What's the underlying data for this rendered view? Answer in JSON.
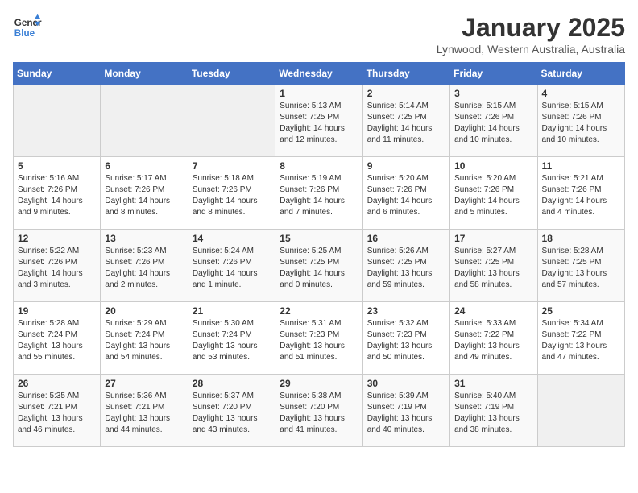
{
  "header": {
    "logo_line1": "General",
    "logo_line2": "Blue",
    "title": "January 2025",
    "subtitle": "Lynwood, Western Australia, Australia"
  },
  "days_of_week": [
    "Sunday",
    "Monday",
    "Tuesday",
    "Wednesday",
    "Thursday",
    "Friday",
    "Saturday"
  ],
  "weeks": [
    [
      {
        "day": "",
        "info": ""
      },
      {
        "day": "",
        "info": ""
      },
      {
        "day": "",
        "info": ""
      },
      {
        "day": "1",
        "info": "Sunrise: 5:13 AM\nSunset: 7:25 PM\nDaylight: 14 hours\nand 12 minutes."
      },
      {
        "day": "2",
        "info": "Sunrise: 5:14 AM\nSunset: 7:25 PM\nDaylight: 14 hours\nand 11 minutes."
      },
      {
        "day": "3",
        "info": "Sunrise: 5:15 AM\nSunset: 7:26 PM\nDaylight: 14 hours\nand 10 minutes."
      },
      {
        "day": "4",
        "info": "Sunrise: 5:15 AM\nSunset: 7:26 PM\nDaylight: 14 hours\nand 10 minutes."
      }
    ],
    [
      {
        "day": "5",
        "info": "Sunrise: 5:16 AM\nSunset: 7:26 PM\nDaylight: 14 hours\nand 9 minutes."
      },
      {
        "day": "6",
        "info": "Sunrise: 5:17 AM\nSunset: 7:26 PM\nDaylight: 14 hours\nand 8 minutes."
      },
      {
        "day": "7",
        "info": "Sunrise: 5:18 AM\nSunset: 7:26 PM\nDaylight: 14 hours\nand 8 minutes."
      },
      {
        "day": "8",
        "info": "Sunrise: 5:19 AM\nSunset: 7:26 PM\nDaylight: 14 hours\nand 7 minutes."
      },
      {
        "day": "9",
        "info": "Sunrise: 5:20 AM\nSunset: 7:26 PM\nDaylight: 14 hours\nand 6 minutes."
      },
      {
        "day": "10",
        "info": "Sunrise: 5:20 AM\nSunset: 7:26 PM\nDaylight: 14 hours\nand 5 minutes."
      },
      {
        "day": "11",
        "info": "Sunrise: 5:21 AM\nSunset: 7:26 PM\nDaylight: 14 hours\nand 4 minutes."
      }
    ],
    [
      {
        "day": "12",
        "info": "Sunrise: 5:22 AM\nSunset: 7:26 PM\nDaylight: 14 hours\nand 3 minutes."
      },
      {
        "day": "13",
        "info": "Sunrise: 5:23 AM\nSunset: 7:26 PM\nDaylight: 14 hours\nand 2 minutes."
      },
      {
        "day": "14",
        "info": "Sunrise: 5:24 AM\nSunset: 7:26 PM\nDaylight: 14 hours\nand 1 minute."
      },
      {
        "day": "15",
        "info": "Sunrise: 5:25 AM\nSunset: 7:25 PM\nDaylight: 14 hours\nand 0 minutes."
      },
      {
        "day": "16",
        "info": "Sunrise: 5:26 AM\nSunset: 7:25 PM\nDaylight: 13 hours\nand 59 minutes."
      },
      {
        "day": "17",
        "info": "Sunrise: 5:27 AM\nSunset: 7:25 PM\nDaylight: 13 hours\nand 58 minutes."
      },
      {
        "day": "18",
        "info": "Sunrise: 5:28 AM\nSunset: 7:25 PM\nDaylight: 13 hours\nand 57 minutes."
      }
    ],
    [
      {
        "day": "19",
        "info": "Sunrise: 5:28 AM\nSunset: 7:24 PM\nDaylight: 13 hours\nand 55 minutes."
      },
      {
        "day": "20",
        "info": "Sunrise: 5:29 AM\nSunset: 7:24 PM\nDaylight: 13 hours\nand 54 minutes."
      },
      {
        "day": "21",
        "info": "Sunrise: 5:30 AM\nSunset: 7:24 PM\nDaylight: 13 hours\nand 53 minutes."
      },
      {
        "day": "22",
        "info": "Sunrise: 5:31 AM\nSunset: 7:23 PM\nDaylight: 13 hours\nand 51 minutes."
      },
      {
        "day": "23",
        "info": "Sunrise: 5:32 AM\nSunset: 7:23 PM\nDaylight: 13 hours\nand 50 minutes."
      },
      {
        "day": "24",
        "info": "Sunrise: 5:33 AM\nSunset: 7:22 PM\nDaylight: 13 hours\nand 49 minutes."
      },
      {
        "day": "25",
        "info": "Sunrise: 5:34 AM\nSunset: 7:22 PM\nDaylight: 13 hours\nand 47 minutes."
      }
    ],
    [
      {
        "day": "26",
        "info": "Sunrise: 5:35 AM\nSunset: 7:21 PM\nDaylight: 13 hours\nand 46 minutes."
      },
      {
        "day": "27",
        "info": "Sunrise: 5:36 AM\nSunset: 7:21 PM\nDaylight: 13 hours\nand 44 minutes."
      },
      {
        "day": "28",
        "info": "Sunrise: 5:37 AM\nSunset: 7:20 PM\nDaylight: 13 hours\nand 43 minutes."
      },
      {
        "day": "29",
        "info": "Sunrise: 5:38 AM\nSunset: 7:20 PM\nDaylight: 13 hours\nand 41 minutes."
      },
      {
        "day": "30",
        "info": "Sunrise: 5:39 AM\nSunset: 7:19 PM\nDaylight: 13 hours\nand 40 minutes."
      },
      {
        "day": "31",
        "info": "Sunrise: 5:40 AM\nSunset: 7:19 PM\nDaylight: 13 hours\nand 38 minutes."
      },
      {
        "day": "",
        "info": ""
      }
    ]
  ]
}
